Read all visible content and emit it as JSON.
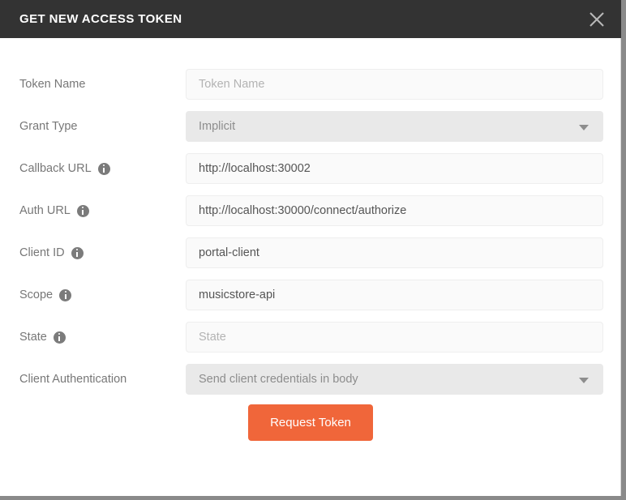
{
  "window": {
    "title": "GET NEW ACCESS TOKEN",
    "close_icon": "close-icon",
    "header_bg": "#333333",
    "accent": "#f0663a"
  },
  "form": {
    "rows": [
      {
        "label": "Token Name",
        "has_info": false,
        "control": "text",
        "value": "",
        "placeholder": "Token Name"
      },
      {
        "label": "Grant Type",
        "has_info": false,
        "control": "select",
        "value": "Implicit",
        "placeholder": ""
      },
      {
        "label": "Callback URL",
        "has_info": true,
        "control": "text",
        "value": "http://localhost:30002",
        "placeholder": ""
      },
      {
        "label": "Auth URL",
        "has_info": true,
        "control": "text",
        "value": "http://localhost:30000/connect/authorize",
        "placeholder": ""
      },
      {
        "label": "Client ID",
        "has_info": true,
        "control": "text",
        "value": "portal-client",
        "placeholder": ""
      },
      {
        "label": "Scope",
        "has_info": true,
        "control": "text",
        "value": "musicstore-api",
        "placeholder": ""
      },
      {
        "label": "State",
        "has_info": true,
        "control": "text",
        "value": "",
        "placeholder": "State"
      },
      {
        "label": "Client Authentication",
        "has_info": false,
        "control": "select",
        "value": "Send client credentials in body",
        "placeholder": ""
      }
    ],
    "submit_label": "Request Token"
  }
}
